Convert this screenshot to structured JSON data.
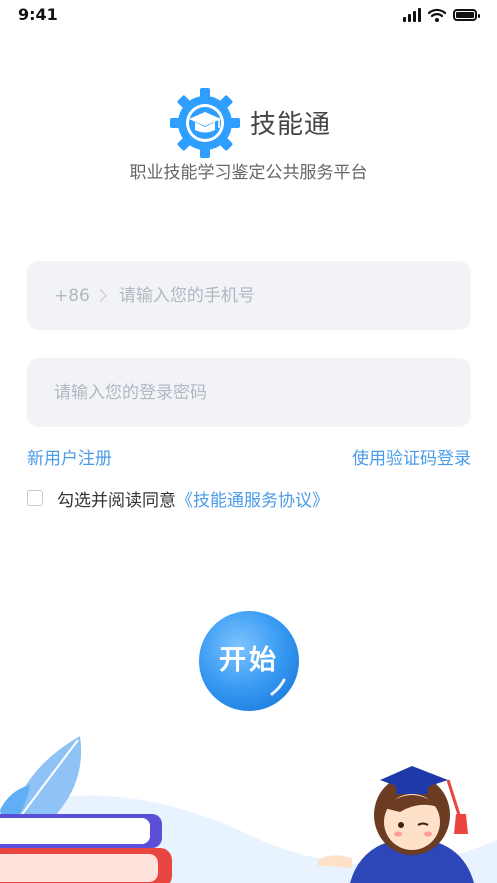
{
  "status_bar": {
    "time": "9:41"
  },
  "app": {
    "name": "技能通",
    "subtitle": "职业技能学习鉴定公共服务平台"
  },
  "login": {
    "country_code": "+86",
    "phone_placeholder": "请输入您的手机号",
    "password_placeholder": "请输入您的登录密码",
    "register_link": "新用户注册",
    "sms_login_link": "使用验证码登录",
    "agree_text": "勾选并阅读同意",
    "agreement_link": "《技能通服务协议》",
    "agreed": false,
    "start_button": "开始"
  },
  "colors": {
    "brand_blue": "#2e9fff",
    "link_blue": "#4a9be8",
    "field_bg": "#f2f3f7"
  },
  "icons": [
    "gear-graduation-cap-logo",
    "chevron-right-icon",
    "checkbox-icon",
    "signal-icon",
    "wifi-icon",
    "battery-icon"
  ]
}
